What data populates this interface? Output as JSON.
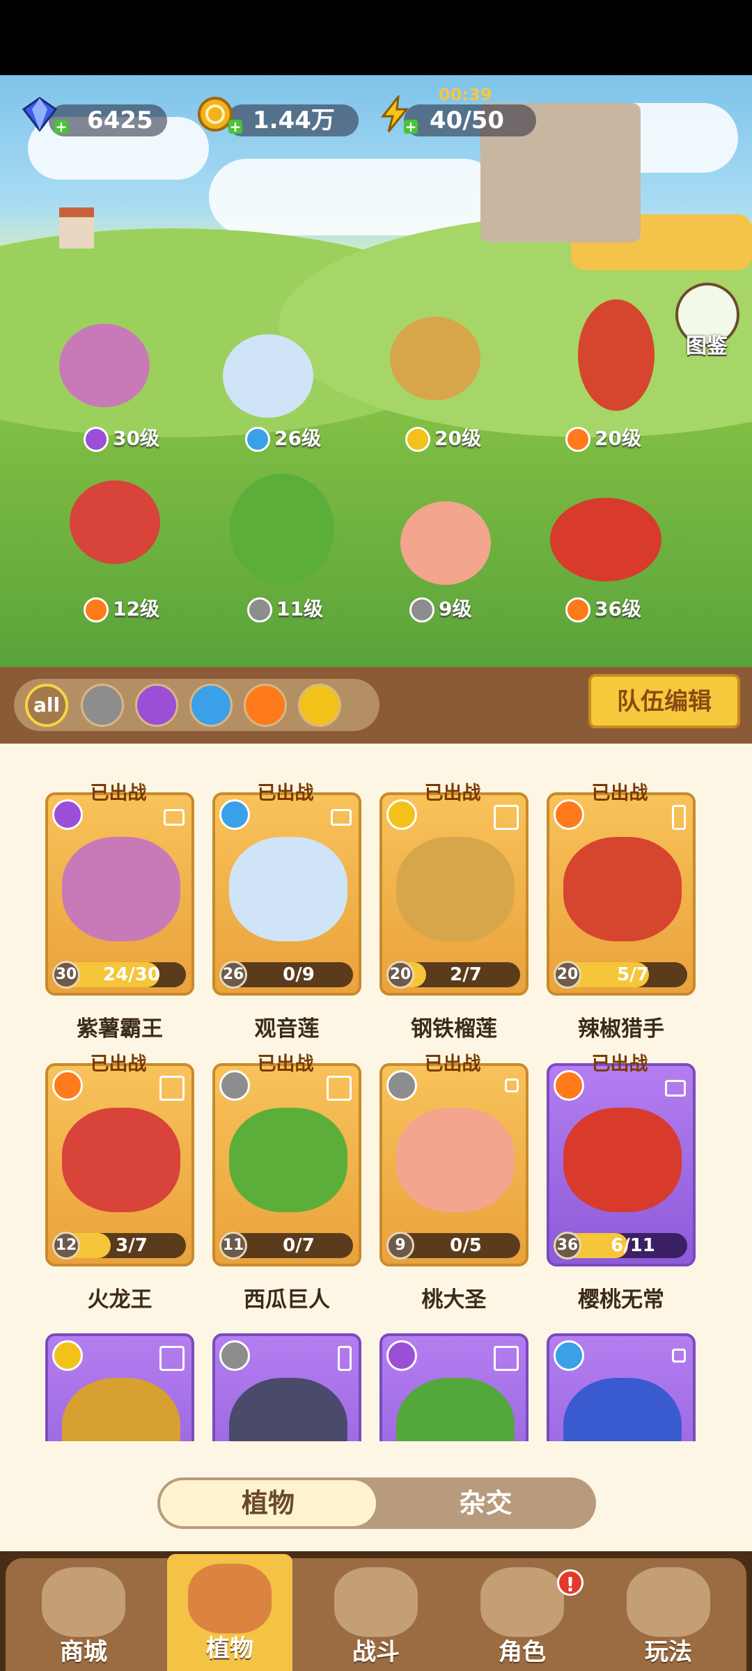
{
  "resources": {
    "gems": "6425",
    "coins": "1.44万",
    "energy": "40/50",
    "energy_timer": "00:39"
  },
  "album_label": "图鉴",
  "lineup": [
    {
      "level": "30级",
      "element": "poison"
    },
    {
      "level": "26级",
      "element": "water"
    },
    {
      "level": "20级",
      "element": "lightning"
    },
    {
      "level": "20级",
      "element": "fire"
    },
    {
      "level": "12级",
      "element": "fire"
    },
    {
      "level": "11级",
      "element": "sword"
    },
    {
      "level": "9级",
      "element": "sword"
    },
    {
      "level": "36级",
      "element": "fire"
    }
  ],
  "filters": [
    "all",
    "sword",
    "poison",
    "water",
    "fire",
    "lightning"
  ],
  "team_edit_label": "队伍编辑",
  "deployed_label": "已出战",
  "cards": [
    {
      "name": "紫薯霸王",
      "level": "30",
      "progress": "24/30",
      "element": "poison",
      "purple": false
    },
    {
      "name": "观音莲",
      "level": "26",
      "progress": "0/9",
      "element": "water",
      "purple": false
    },
    {
      "name": "钢铁榴莲",
      "level": "20",
      "progress": "2/7",
      "element": "lightning",
      "purple": false
    },
    {
      "name": "辣椒猎手",
      "level": "20",
      "progress": "5/7",
      "element": "fire",
      "purple": false
    },
    {
      "name": "火龙王",
      "level": "12",
      "progress": "3/7",
      "element": "fire",
      "purple": false
    },
    {
      "name": "西瓜巨人",
      "level": "11",
      "progress": "0/7",
      "element": "sword",
      "purple": false
    },
    {
      "name": "桃大圣",
      "level": "9",
      "progress": "0/5",
      "element": "sword",
      "purple": false
    },
    {
      "name": "樱桃无常",
      "level": "36",
      "progress": "6/11",
      "element": "fire",
      "purple": true
    }
  ],
  "partial_cards": [
    {
      "element": "lightning"
    },
    {
      "element": "sword"
    },
    {
      "element": "poison"
    },
    {
      "element": "water"
    }
  ],
  "toggle": {
    "on": "植物",
    "off": "杂交"
  },
  "nav": [
    {
      "label": "商城"
    },
    {
      "label": "植物"
    },
    {
      "label": "战斗"
    },
    {
      "label": "角色",
      "badge": "!"
    },
    {
      "label": "玩法"
    }
  ],
  "colors": {
    "fire": "#ff7a1a",
    "water": "#3aa0e8",
    "poison": "#9b4fd6",
    "lightning": "#f2c21b",
    "sword": "#8d8d8d"
  }
}
